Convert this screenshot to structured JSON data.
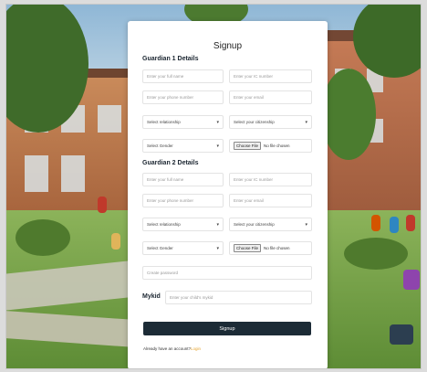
{
  "form": {
    "title": "Signup",
    "guardian1": {
      "heading": "Guardian 1 Details",
      "full_name_placeholder": "Enter your full name",
      "ic_placeholder": "Enter your IC number",
      "phone_placeholder": "Enter your phone number",
      "email_placeholder": "Enter your email",
      "relationship_selected": "Select relationship",
      "citizenship_selected": "Select your citizenship",
      "gender_selected": "Select Gender",
      "file_button": "Choose File",
      "file_status": "No file chosen"
    },
    "guardian2": {
      "heading": "Guardian 2 Details",
      "full_name_placeholder": "Enter your full name",
      "ic_placeholder": "Enter your IC number",
      "phone_placeholder": "Enter your phone number",
      "email_placeholder": "Enter your email",
      "relationship_selected": "Select relationship",
      "citizenship_selected": "Select your citizenship",
      "gender_selected": "Select Gender",
      "file_button": "Choose File",
      "file_status": "No file chosen"
    },
    "password_placeholder": "Create password",
    "mykid_label": "Mykid",
    "mykid_placeholder": "Enter your child's mykid",
    "submit_label": "Signup",
    "footer_text": "Already have an account?",
    "footer_link": "Login"
  },
  "colors": {
    "button_bg": "#1c2b36",
    "link": "#e6a431"
  },
  "icons": {
    "dropdown": "chevron-down-icon"
  }
}
